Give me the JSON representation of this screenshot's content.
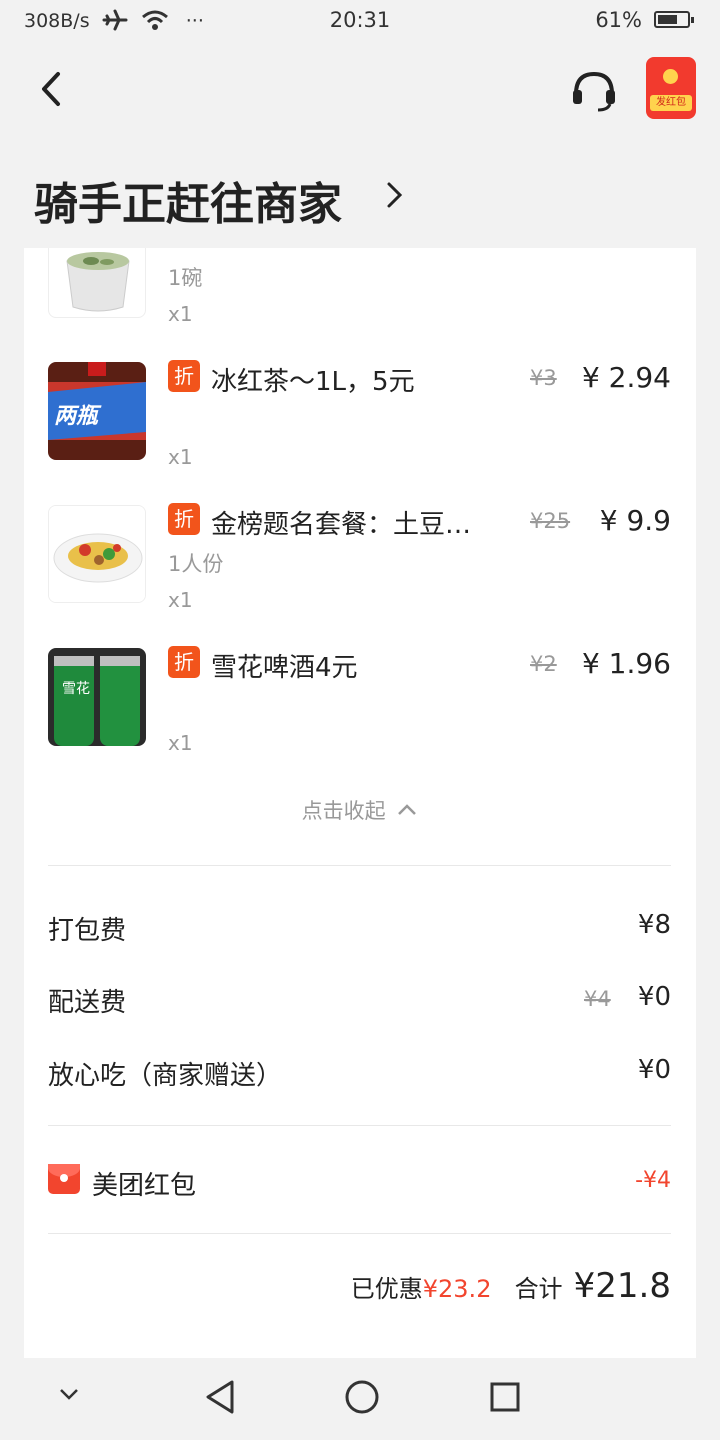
{
  "status_bar": {
    "net_speed": "308B/s",
    "more": "···",
    "time": "20:31",
    "battery": "61%"
  },
  "header": {
    "title": "骑手正赶往商家",
    "hongbao_label": "发红包"
  },
  "items": [
    {
      "name": "",
      "spec": "1碗",
      "qty": "x1",
      "has_discount": false
    },
    {
      "name": "冰红茶～1L，5元",
      "spec": "",
      "qty": "x1",
      "has_discount": true,
      "orig_price": "¥3",
      "price": "¥ 2.94",
      "thumb_text": "两瓶"
    },
    {
      "name": "金榜题名套餐：土豆…",
      "spec": "1人份",
      "qty": "x1",
      "has_discount": true,
      "orig_price": "¥25",
      "price": "¥ 9.9"
    },
    {
      "name": "雪花啤酒4元",
      "spec": "",
      "qty": "x1",
      "has_discount": true,
      "orig_price": "¥2",
      "price": "¥ 1.96",
      "thumb_text": "雪花"
    }
  ],
  "discount_tag": "折",
  "collapse_label": "点击收起",
  "fees": {
    "packing": {
      "label": "打包费",
      "value": "¥8"
    },
    "delivery": {
      "label": "配送费",
      "orig": "¥4",
      "value": "¥0"
    },
    "assurance": {
      "label": "放心吃（商家赠送）",
      "value": "¥0"
    }
  },
  "redpacket": {
    "label": "美团红包",
    "value": "-¥4"
  },
  "summary": {
    "saved_label": "已优惠",
    "saved_value": "¥23.2",
    "total_label": "合计",
    "total_value": "¥21.8"
  },
  "colors": {
    "accent": "#f2452e",
    "tag": "#f2541b",
    "bg": "#f2f2f2"
  }
}
